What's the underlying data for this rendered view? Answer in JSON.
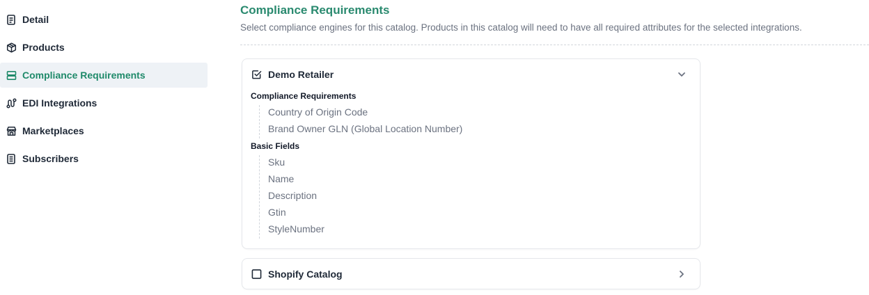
{
  "sidebar": {
    "items": [
      {
        "label": "Detail",
        "icon": "document-icon"
      },
      {
        "label": "Products",
        "icon": "box-icon"
      },
      {
        "label": "Compliance Requirements",
        "icon": "server-icon",
        "active": true
      },
      {
        "label": "EDI Integrations",
        "icon": "route-icon"
      },
      {
        "label": "Marketplaces",
        "icon": "store-icon"
      },
      {
        "label": "Subscribers",
        "icon": "list-icon"
      }
    ]
  },
  "main": {
    "title": "Compliance Requirements",
    "subtitle": "Select compliance engines for this catalog. Products in this catalog will need to have all required attributes for the selected integrations.",
    "integrations": [
      {
        "name": "Demo Retailer",
        "checked": true,
        "expanded": true,
        "sections": [
          {
            "title": "Compliance Requirements",
            "items": [
              "Country of Origin Code",
              "Brand Owner GLN (Global Location Number)"
            ]
          },
          {
            "title": "Basic Fields",
            "items": [
              "Sku",
              "Name",
              "Description",
              "Gtin",
              "StyleNumber"
            ]
          }
        ]
      },
      {
        "name": "Shopify Catalog",
        "checked": false,
        "expanded": false
      }
    ]
  },
  "colors": {
    "accent": "#2a8a6f",
    "active_bg": "#eef2f6",
    "muted_text": "#6b7280"
  }
}
